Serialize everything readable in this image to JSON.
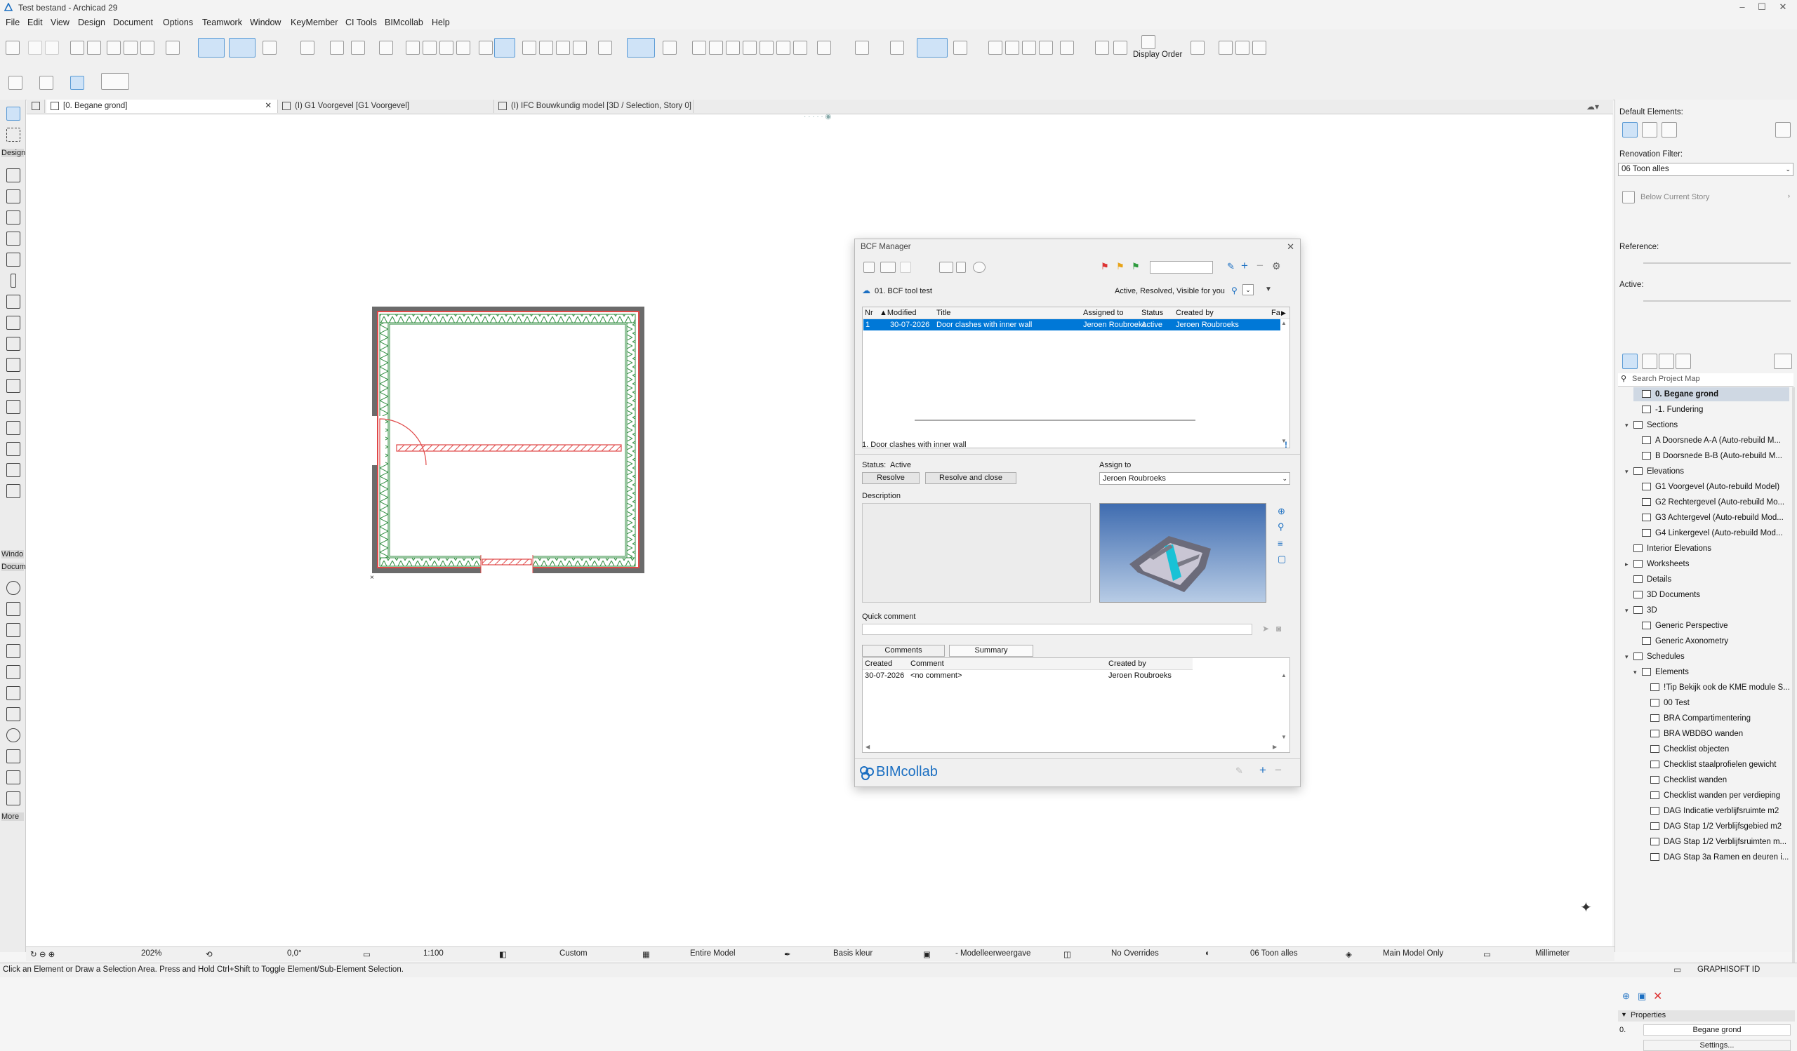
{
  "window": {
    "title": "Test bestand - Archicad 29",
    "controls": [
      "–",
      "☐",
      "✕"
    ]
  },
  "menu": [
    "File",
    "Edit",
    "View",
    "Design",
    "Document",
    "Options",
    "Teamwork",
    "Window",
    "KeyMember",
    "CI Tools",
    "BIMcollab",
    "Help"
  ],
  "toolbar": {
    "display_order_label": "Display Order"
  },
  "tabs": [
    {
      "label": "[0. Begane grond]",
      "close": "✕"
    },
    {
      "label": "(I) G1 Voorgevel [G1 Voorgevel]"
    },
    {
      "label": "(I) IFC Bouwkundig model [3D / Selection, Story 0]"
    }
  ],
  "toolbox": {
    "design_header": "Design",
    "window_header": "Windo",
    "document_header": "Docum",
    "more_label": "More"
  },
  "right_panel": {
    "default_elements_label": "Default Elements:",
    "renovation_filter_label": "Renovation Filter:",
    "renovation_filter_value": "06 Toon alles",
    "below_current_story": "Below Current Story",
    "reference_label": "Reference:",
    "active_label": "Active:",
    "search_placeholder": "Search Project Map",
    "project_map": [
      {
        "label": "0. Begane grond",
        "indent": 2,
        "selected": true
      },
      {
        "label": "-1. Fundering",
        "indent": 2
      },
      {
        "label": "Sections",
        "indent": 1,
        "expanded": true
      },
      {
        "label": "A Doorsnede A-A (Auto-rebuild M...",
        "indent": 2
      },
      {
        "label": "B Doorsnede B-B (Auto-rebuild M...",
        "indent": 2
      },
      {
        "label": "Elevations",
        "indent": 1,
        "expanded": true
      },
      {
        "label": "G1 Voorgevel (Auto-rebuild Model)",
        "indent": 2
      },
      {
        "label": "G2 Rechtergevel (Auto-rebuild Mo...",
        "indent": 2
      },
      {
        "label": "G3 Achtergevel (Auto-rebuild Mod...",
        "indent": 2
      },
      {
        "label": "G4 Linkergevel (Auto-rebuild Mod...",
        "indent": 2
      },
      {
        "label": "Interior Elevations",
        "indent": 1
      },
      {
        "label": "Worksheets",
        "indent": 1,
        "collapsed": true
      },
      {
        "label": "Details",
        "indent": 1
      },
      {
        "label": "3D Documents",
        "indent": 1
      },
      {
        "label": "3D",
        "indent": 1,
        "expanded": true
      },
      {
        "label": "Generic Perspective",
        "indent": 2
      },
      {
        "label": "Generic Axonometry",
        "indent": 2
      },
      {
        "label": "Schedules",
        "indent": 1,
        "expanded": true
      },
      {
        "label": "Elements",
        "indent": 2,
        "expanded": true
      },
      {
        "label": "!Tip Bekijk ook de KME module S...",
        "indent": 3
      },
      {
        "label": "00 Test",
        "indent": 3
      },
      {
        "label": "BRA Compartimentering",
        "indent": 3
      },
      {
        "label": "BRA WBDBO wanden",
        "indent": 3
      },
      {
        "label": "Checklist objecten",
        "indent": 3
      },
      {
        "label": "Checklist staalprofielen gewicht",
        "indent": 3
      },
      {
        "label": "Checklist wanden",
        "indent": 3
      },
      {
        "label": "Checklist wanden per verdieping",
        "indent": 3
      },
      {
        "label": "DAG Indicatie verblijfsruimte m2",
        "indent": 3
      },
      {
        "label": "DAG Stap 1/2 Verblijfsgebied m2",
        "indent": 3
      },
      {
        "label": "DAG Stap 1/2 Verblijfsruimten m...",
        "indent": 3
      },
      {
        "label": "DAG Stap 3a Ramen en deuren i...",
        "indent": 3
      }
    ],
    "properties_label": "Properties",
    "properties_id": "0.",
    "properties_name": "Begane grond",
    "settings_label": "Settings..."
  },
  "bottom_bar": {
    "zoom": "202%",
    "angle": "0,0°",
    "scale": "1:100",
    "layer_combo": "Custom",
    "structure": "Entire Model",
    "pen_set": "Basis kleur",
    "mvo": "- Modelleerweergave",
    "overrides": "No Overrides",
    "renovation": "06 Toon alles",
    "model_only": "Main Model Only",
    "unit": "Millimeter"
  },
  "status_bar": {
    "hint": "Click an Element or Draw a Selection Area. Press and Hold Ctrl+Shift to Toggle Element/Sub-Element Selection.",
    "graphisoft_id": "GRAPHISOFT ID"
  },
  "bcf": {
    "title": "BCF Manager",
    "project": "01. BCF tool test",
    "filter_text": "Active, Resolved, Visible for you",
    "columns": [
      "Nr",
      "Modified",
      "Title",
      "Assigned to",
      "Status",
      "Created by",
      "Fa"
    ],
    "issues": [
      {
        "nr": "1",
        "modified": "30-07-2026",
        "title": "Door clashes with inner wall",
        "assigned": "Jeroen Roubroeks",
        "status": "Active",
        "created_by": "Jeroen Roubroeks"
      }
    ],
    "issue_header": "1. Door clashes with inner wall",
    "issue_priority": "!",
    "status_label": "Status:",
    "status_value": "Active",
    "resolve_btn": "Resolve",
    "resolve_close_btn": "Resolve and close",
    "assign_label": "Assign to",
    "assign_value": "Jeroen Roubroeks",
    "description_label": "Description",
    "quick_comment_label": "Quick comment",
    "tab_comments": "Comments",
    "tab_summary": "Summary",
    "comment_columns": [
      "Created",
      "Comment",
      "Created by"
    ],
    "comments": [
      {
        "created": "30-07-2026",
        "comment": "<no comment>",
        "created_by": "Jeroen Roubroeks"
      }
    ],
    "brand": "BIMcollab"
  },
  "colors": {
    "selection": "#0078d7",
    "wall_hatch": "#2e8b3e",
    "edited_element": "#e04848",
    "bimcollab_blue": "#1b6fc2"
  }
}
